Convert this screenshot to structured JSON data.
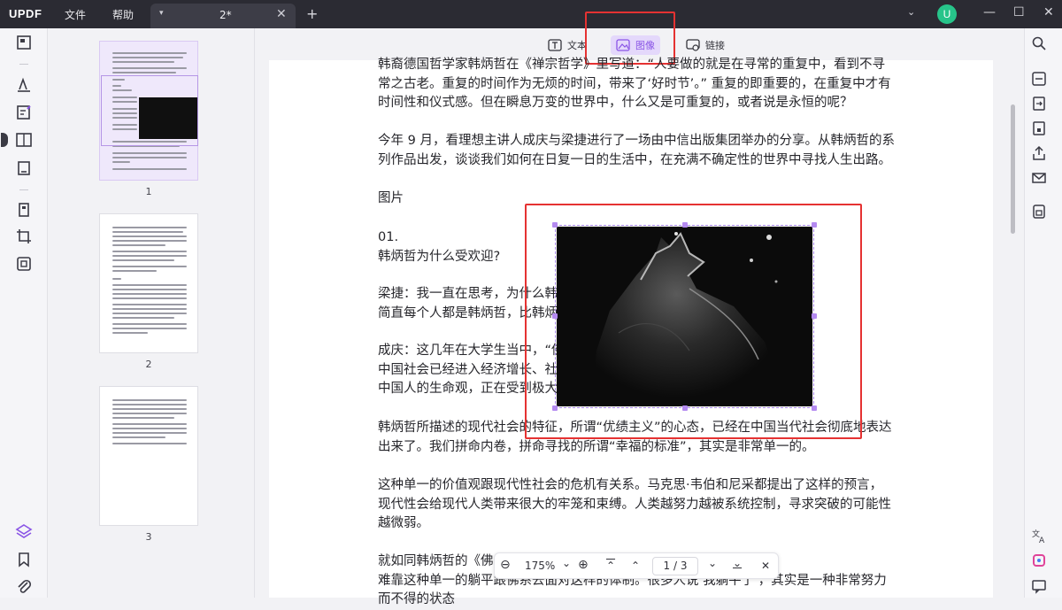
{
  "app": {
    "logo": "UPDF",
    "menu": {
      "file": "文件",
      "help": "帮助"
    },
    "tab": {
      "caret": "▾",
      "title": "2*",
      "close": "✕",
      "add": "+"
    },
    "window": {
      "chevron": "⌄",
      "avatar": "U",
      "minimize": "—",
      "maximize": "☐",
      "close": "✕"
    }
  },
  "toolbar": {
    "text_label": "文本",
    "image_label": "图像",
    "link_label": "链接",
    "accent_color": "#8a55e6",
    "highlight_color": "#e53232"
  },
  "thumbnails": [
    {
      "number": "1"
    },
    {
      "number": "2"
    },
    {
      "number": "3"
    }
  ],
  "document": {
    "paragraphs": [
      [
        "韩裔德国哲学家韩炳哲在《禅宗哲学》里写道：“人要做的就是在寻常的重复中，看到不寻",
        "常之古老。重复的时间作为无烦的时间，带来了‘好时节’。” 重复的即重要的，在重复中才有",
        "时间性和仪式感。但在瞬息万变的世界中，什么又是可重复的，或者说是永恒的呢？"
      ],
      [
        "今年 9 月，看理想主讲人成庆与梁捷进行了一场由中信出版集团举办的分享。从韩炳哲的系",
        "列作品出发，谈谈我们如何在日复一日的生活中，在充满不确定性的世界中寻找人生出路。"
      ],
      [
        "图片"
      ],
      [
        "01.",
        "韩炳哲为什么受欢迎?"
      ],
      [
        "梁捷：我一直在思考，为什么韩炳哲这么受欢迎。如果我的理解准确的，",
        "简直每个人都是韩炳哲，比韩炳哲还像韩炳哲，人们想要躲避韩炳哲。"
      ],
      [
        "成庆：这几年在大学生当中，“佛系”引起了大量的讨论。现在",
        "中国社会已经进入经济增长、社会发展的新阶段，过去 40 年来形成的",
        "中国人的生命观，正在受到极大的挑战。"
      ],
      [
        "韩炳哲所描述的现代社会的特征，所谓“优绩主义”的心态，已经在中国当代社会彻底地表达",
        "出来了。我们拼命内卷，拼命寻找的所谓“幸福的标准”，其实是非常单一的。"
      ],
      [
        "这种单一的价值观跟现代性社会的危机有关系。马克思·韦伯和尼采都提出了这样的预言，",
        "现代性会给现代人类带来很大的牢笼和束缚。人类越努力越被系统控制，寻求突破的可能性",
        "越微弱。"
      ],
      [
        "就如同韩炳哲的《佛系》所说的：在跟随既有的体系的社会之后，很",
        "难靠这种单一的躺平跟佛系去面对这样的体制。很多人说‘我躺平了’，其实是一种非常努力",
        "而不得的状态"
      ]
    ]
  },
  "zoombar": {
    "minus": "⊖",
    "zoom_level": "175%",
    "dropdown": "⌄",
    "plus": "⊕",
    "first_page": "⌃",
    "prev_page": "⌃",
    "page_indicator": "1 / 3",
    "next_page": "⌄",
    "last_page": "⌄",
    "close": "✕"
  }
}
